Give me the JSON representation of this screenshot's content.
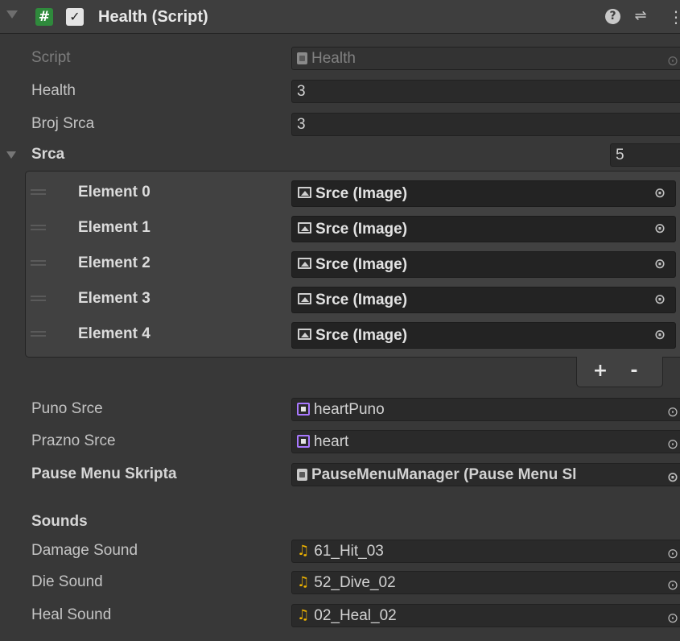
{
  "component": {
    "title": "Health (Script)",
    "enabled_check": "✓",
    "hash_glyph": "#",
    "help_glyph": "?",
    "presets_glyph": "⇌",
    "menu_glyph": "⋮"
  },
  "fields": {
    "script": {
      "label": "Script",
      "value": "Health"
    },
    "health": {
      "label": "Health",
      "value": "3"
    },
    "broj_srca": {
      "label": "Broj Srca",
      "value": "3"
    }
  },
  "srca": {
    "label": "Srca",
    "size": "5",
    "elements": [
      {
        "label": "Element 0",
        "value": "Srce (Image)"
      },
      {
        "label": "Element 1",
        "value": "Srce (Image)"
      },
      {
        "label": "Element 2",
        "value": "Srce (Image)"
      },
      {
        "label": "Element 3",
        "value": "Srce (Image)"
      },
      {
        "label": "Element 4",
        "value": "Srce (Image)"
      }
    ],
    "add_label": "+",
    "remove_label": "-"
  },
  "sprites": {
    "puno_srce": {
      "label": "Puno Srce",
      "value": "heartPuno"
    },
    "prazno_srce": {
      "label": "Prazno Srce",
      "value": "heart"
    },
    "pause_menu": {
      "label": "Pause Menu Skripta",
      "value": "PauseMenuManager (Pause Menu Sl"
    }
  },
  "sounds": {
    "header": "Sounds",
    "note_glyph": "♫",
    "damage": {
      "label": "Damage Sound",
      "value": "61_Hit_03"
    },
    "die": {
      "label": "Die Sound",
      "value": "52_Dive_02"
    },
    "heal": {
      "label": "Heal Sound",
      "value": "02_Heal_02"
    }
  },
  "picker_glyph": "⊙",
  "colors": {
    "panel_bg": "#383838",
    "field_bg": "#2a2a2a",
    "script_icon_green": "#2f8a3c",
    "sprite_accent": "#a878ff",
    "audio_accent": "#f0b400"
  }
}
